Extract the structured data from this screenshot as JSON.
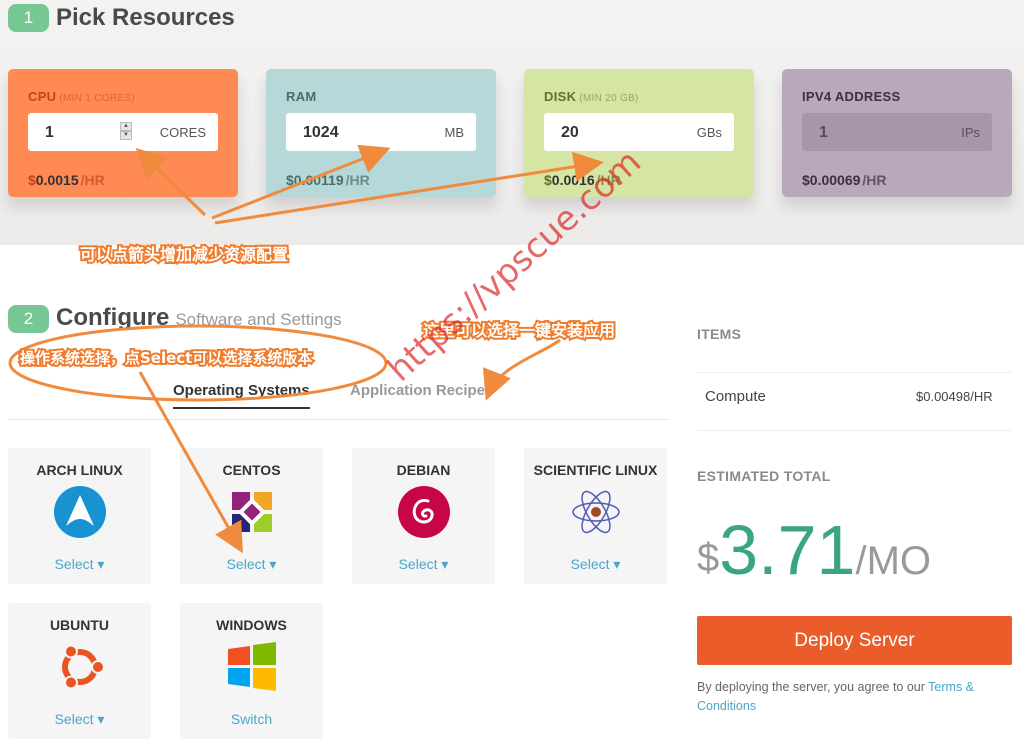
{
  "step1": {
    "number": "1",
    "title": "Pick Resources"
  },
  "resources": [
    {
      "label": "CPU",
      "min": "(MIN 1 CORES)",
      "value": "1",
      "unit": "CORES",
      "price": "0.0015",
      "per": "/HR",
      "bg": "#ff8a53",
      "label_color": "#c2461d"
    },
    {
      "label": "RAM",
      "min": "",
      "value": "1024",
      "unit": "MB",
      "price": "0.00119",
      "per": "/HR",
      "bg": "#b6d8d8",
      "label_color": "#4d6d6d"
    },
    {
      "label": "DISK",
      "min": "(MIN 20 GB)",
      "value": "20",
      "unit": "GBs",
      "price": "0.0016",
      "per": "/HR",
      "bg": "#d5e5a4",
      "label_color": "#5f7030"
    },
    {
      "label": "IPV4 ADDRESS",
      "min": "",
      "value": "1",
      "unit": "IPs",
      "price": "0.00069",
      "per": "/HR",
      "bg": "#b9a7bb",
      "label_color": "#3d2f3e"
    }
  ],
  "currency": "$",
  "step2": {
    "number": "2",
    "title": "Configure",
    "subtitle": "Software and Settings"
  },
  "tabs": [
    "Operating Systems",
    "Application Recipes"
  ],
  "os": [
    {
      "name": "ARCH LINUX",
      "action": "Select",
      "icon": "arch-linux-icon"
    },
    {
      "name": "CENTOS",
      "action": "Select",
      "icon": "centos-icon"
    },
    {
      "name": "DEBIAN",
      "action": "Select",
      "icon": "debian-icon"
    },
    {
      "name": "SCIENTIFIC LINUX",
      "action": "Select",
      "icon": "scientific-linux-icon"
    },
    {
      "name": "UBUNTU",
      "action": "Select",
      "icon": "ubuntu-icon"
    },
    {
      "name": "WINDOWS",
      "action": "Switch",
      "icon": "windows-icon"
    }
  ],
  "summary": {
    "items_heading": "ITEMS",
    "item_name": "Compute",
    "item_price": "$0.00498",
    "item_per": "/HR",
    "total_heading": "ESTIMATED TOTAL",
    "total_currency": "$",
    "total_value": "3.71",
    "total_period": "/MO",
    "deploy_label": "Deploy Server",
    "terms_prefix": "By deploying the server, you agree to our",
    "terms_link": "Terms & Conditions",
    "accent_total": "#3aa57f",
    "accent_deploy": "#ea5c29",
    "accent_link": "#4aa6c8"
  },
  "annotations": {
    "arrows_note": "可以点箭头增加减少资源配置",
    "os_note": "操作系统选择，点Select可以选择系统版本",
    "app_note": "这里可以选择一键安装应用",
    "watermark": "https://vpscue.com"
  }
}
